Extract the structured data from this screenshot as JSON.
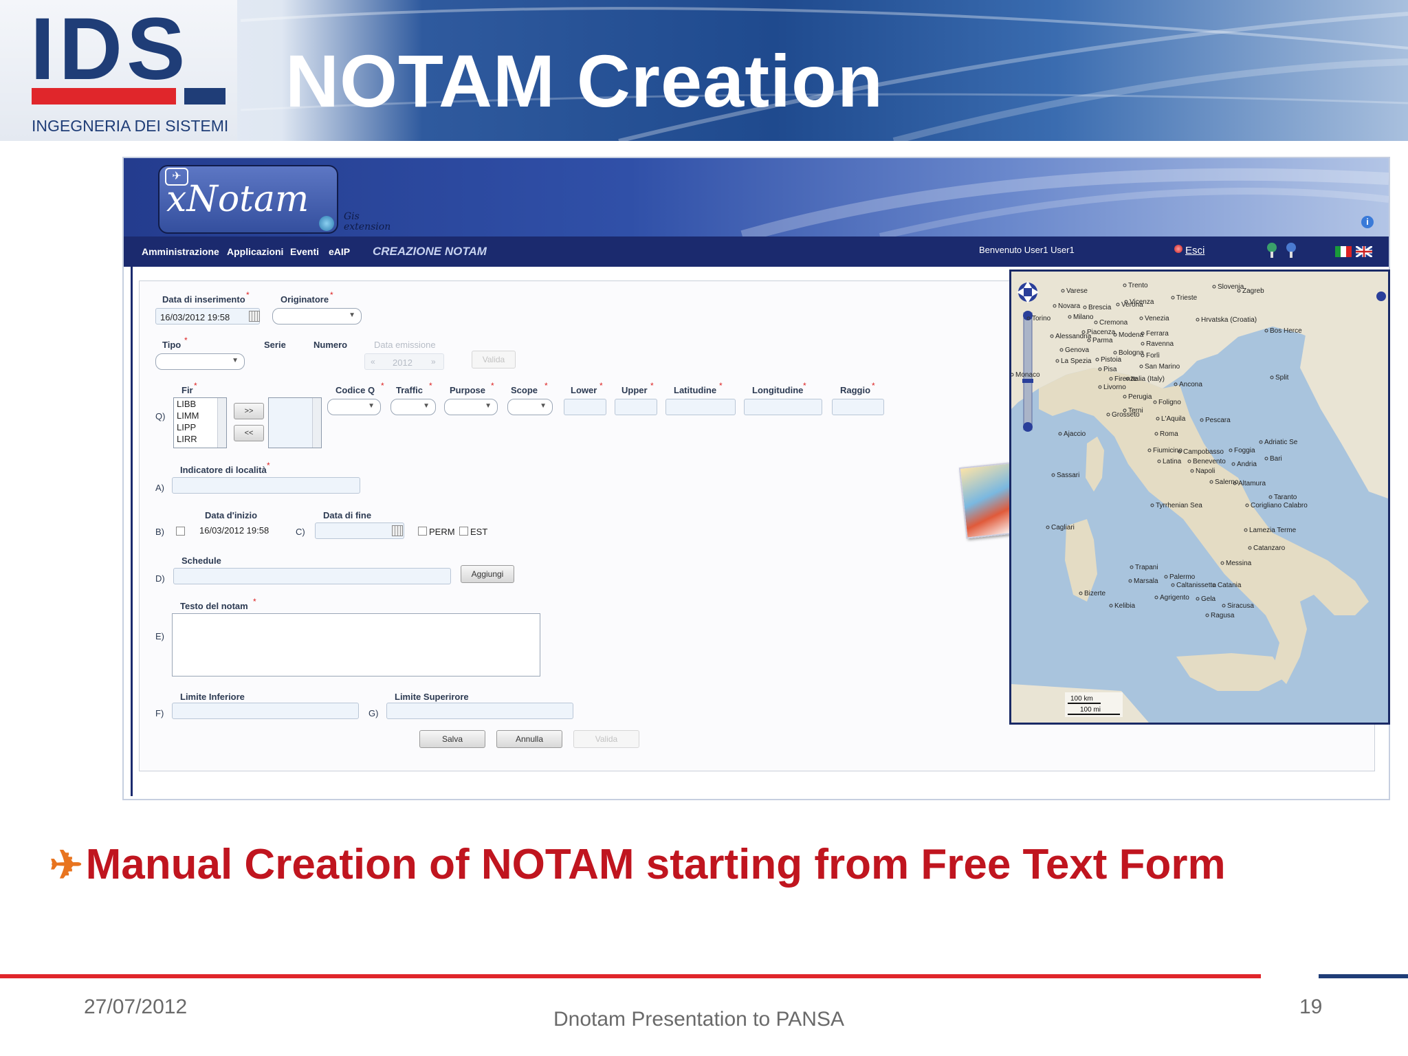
{
  "slide": {
    "logo_letters": "IDS",
    "logo_subtitle": "INGEGNERIA DEI SISTEMI",
    "title": "NOTAM Creation",
    "caption": "Manual Creation of NOTAM starting from Free Text Form",
    "footer_date": "27/07/2012",
    "footer_center": "Dnotam Presentation to PANSA",
    "page_number": "19",
    "colors": {
      "brand_navy": "#1f3d77",
      "brand_red": "#e0262b",
      "caption_red": "#c0151f",
      "arrow_orange": "#e8741f"
    }
  },
  "app": {
    "logo_text": "xNotam",
    "logo_sub": "Gis extension",
    "menu": [
      "Amministrazione",
      "Applicazioni",
      "Eventi",
      "eAIP"
    ],
    "current_page": "CREAZIONE NOTAM",
    "welcome": "Benvenuto User1 User1",
    "logout": "Esci"
  },
  "form": {
    "data_inserimento_label": "Data di inserimento",
    "data_inserimento_value": "16/03/2012 19:58",
    "originatore_label": "Originatore",
    "tipo_label": "Tipo",
    "serie_label": "Serie",
    "numero_label": "Numero",
    "data_emissione_label": "Data emissione",
    "year_value": "2012",
    "year_prev": "«",
    "year_next": "»",
    "valida_top": "Valida",
    "row_q": "Q)",
    "fir_label": "Fir",
    "fir_items": [
      "LIBB",
      "LIMM",
      "LIPP",
      "LIRR"
    ],
    "move_right": ">>",
    "move_left": "<<",
    "codice_q_label": "Codice Q",
    "traffic_label": "Traffic",
    "purpose_label": "Purpose",
    "scope_label": "Scope",
    "lower_label": "Lower",
    "upper_label": "Upper",
    "latitudine_label": "Latitudine",
    "longitudine_label": "Longitudine",
    "raggio_label": "Raggio",
    "row_a": "A)",
    "indicatore_label": "Indicatore di località",
    "row_b": "B)",
    "data_inizio_label": "Data d'inizio",
    "data_inizio_value": "16/03/2012 19:58",
    "row_c": "C)",
    "data_fine_label": "Data di fine",
    "perm_label": "PERM",
    "est_label": "EST",
    "row_d": "D)",
    "schedule_label": "Schedule",
    "aggiungi": "Aggiungi",
    "row_e": "E)",
    "testo_label": "Testo del notam",
    "row_f": "F)",
    "limite_inf_label": "Limite Inferiore",
    "row_g": "G)",
    "limite_sup_label": "Limite Superirore",
    "salva": "Salva",
    "annulla": "Annulla",
    "valida_bottom": "Valida"
  },
  "map": {
    "labels": [
      "Trento",
      "Varese",
      "Verona",
      "Zagreb",
      "Trieste",
      "Novara",
      "Brescia",
      "Vicenza",
      "Milano",
      "Venezia",
      "Torino",
      "Cremona",
      "Hrvatska (Croatia)",
      "Alessandria",
      "Piacenza",
      "Modena",
      "Ferrara",
      "Parma",
      "Ravenna",
      "Genova",
      "Bologna",
      "Forlì",
      "La Spezia",
      "San Marino",
      "Pisa",
      "Pistoia",
      "Firenze",
      "Italia (Italy)",
      "Livorno",
      "Ancona",
      "Perugia",
      "Foligno",
      "Grosseto",
      "Terni",
      "L'Aquila",
      "Pescara",
      "Ajaccio",
      "Roma",
      "Fiumicino",
      "Campobasso",
      "Foggia",
      "Bari",
      "Latina",
      "Benevento",
      "Andria",
      "Sassari",
      "Napoli",
      "Salerno",
      "Altamura",
      "Taranto",
      "Tyrrhenian Sea",
      "Corigliano Calabro",
      "Cagliari",
      "Lamezia Terme",
      "Catanzaro",
      "Messina",
      "Trapani",
      "Palermo",
      "Marsala",
      "Caltanissetta",
      "Catania",
      "Agrigento",
      "Gela",
      "Siracusa",
      "Ragusa",
      "Bizerte",
      "Kelibia",
      "Split",
      "Adriatic Se",
      "Bos Herce",
      "Monaco",
      "Slovenia"
    ],
    "scale_km": "100 km",
    "scale_mi": "100 mi"
  }
}
